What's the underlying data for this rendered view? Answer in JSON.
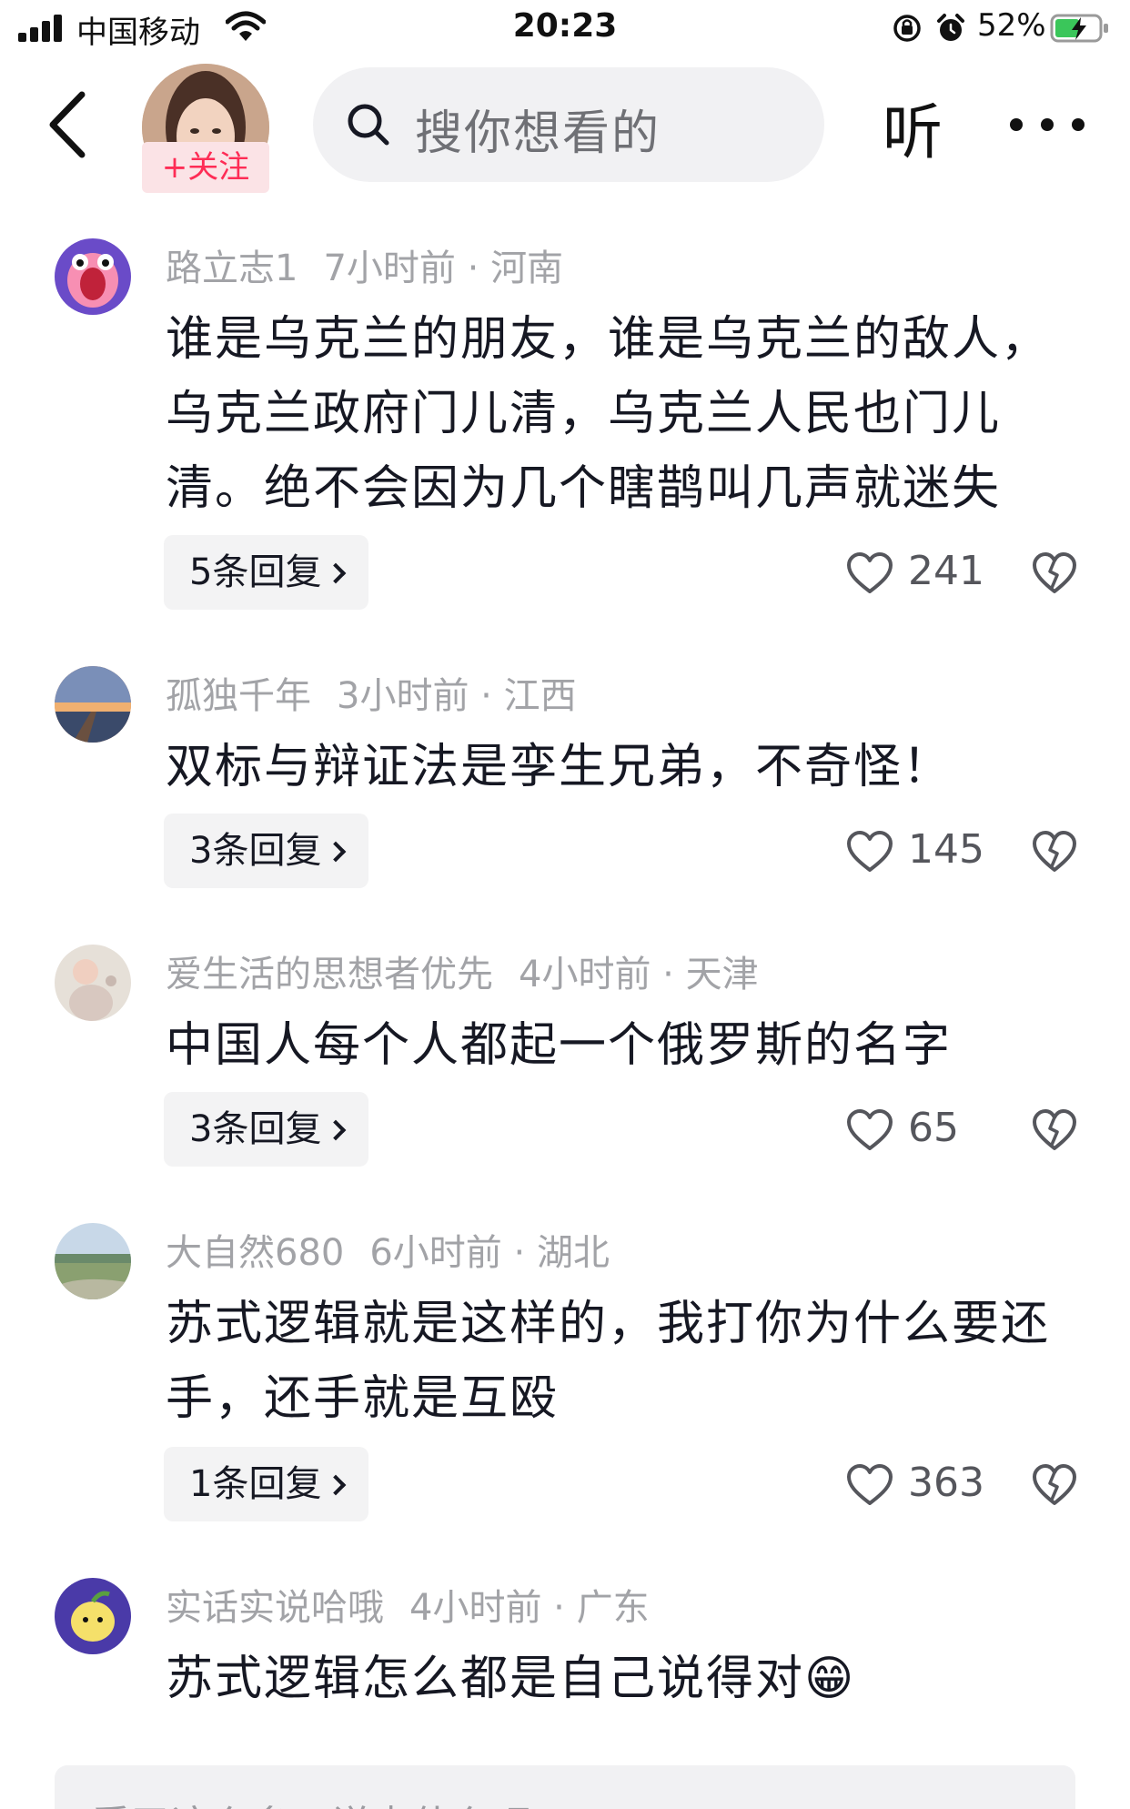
{
  "status_bar": {
    "carrier": "中国移动",
    "time": "20:23",
    "battery": "52%"
  },
  "header": {
    "follow_label": "+关注",
    "search_placeholder": "搜你想看的",
    "listen_label": "听"
  },
  "comments": [
    {
      "username": "路立志1",
      "time": "7小时前",
      "location": "河南",
      "lines": [
        "谁是乌克兰的朋友，谁是乌克兰的敌人，",
        "乌克兰政府门儿清，乌克兰人民也门儿",
        "清。绝不会因为几个瞎鹊叫几声就迷失"
      ],
      "replies": "5条回复",
      "likes": "241"
    },
    {
      "username": "孤独千年",
      "time": "3小时前",
      "location": "江西",
      "lines": [
        "双标与辩证法是孪生兄弟，不奇怪！"
      ],
      "replies": "3条回复",
      "likes": "145"
    },
    {
      "username": "爱生活的思想者优先",
      "time": "4小时前",
      "location": "天津",
      "lines": [
        "中国人每个人都起一个俄罗斯的名字"
      ],
      "replies": "3条回复",
      "likes": "65"
    },
    {
      "username": "大自然680",
      "time": "6小时前",
      "location": "湖北",
      "lines": [
        "苏式逻辑就是这样的，我打你为什么要还",
        "手，还手就是互殴"
      ],
      "replies": "1条回复",
      "likes": "363"
    },
    {
      "username": "实话实说哈哦",
      "time": "4小时前",
      "location": "广东",
      "lines": [
        "苏式逻辑怎么都是自己说得对😁"
      ]
    }
  ],
  "bottom": {
    "placeholder": "看了这么多，说点什么吧"
  },
  "colors": {
    "accent": "#fe2c55",
    "meta_text": "#a2a3a7"
  }
}
